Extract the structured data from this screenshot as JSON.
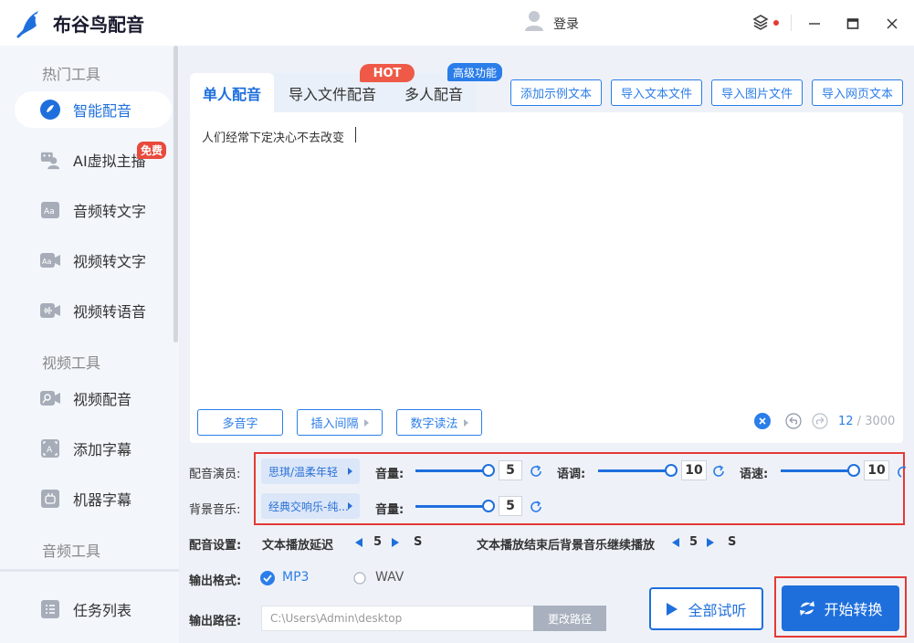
{
  "app": {
    "name": "布谷鸟配音",
    "login_label": "登录"
  },
  "sidebar": {
    "sections": [
      "热门工具",
      "视频工具",
      "音频工具"
    ],
    "items": [
      {
        "label": "智能配音",
        "icon": "smart-dub-icon"
      },
      {
        "label": "AI虚拟主播",
        "icon": "virtual-anchor-icon",
        "badge": "免费"
      },
      {
        "label": "音频转文字",
        "icon": "audio-to-text-icon"
      },
      {
        "label": "视频转文字",
        "icon": "video-to-text-icon"
      },
      {
        "label": "视频转语音",
        "icon": "video-to-voice-icon"
      },
      {
        "label": "视频配音",
        "icon": "video-dub-icon"
      },
      {
        "label": "添加字幕",
        "icon": "add-subtitle-icon"
      },
      {
        "label": "机器字幕",
        "icon": "machine-subtitle-icon"
      },
      {
        "label": "任务列表",
        "icon": "task-list-icon"
      }
    ]
  },
  "tabs": [
    {
      "label": "单人配音"
    },
    {
      "label": "导入文件配音",
      "badge": "HOT"
    },
    {
      "label": "多人配音",
      "badge": "高级功能"
    }
  ],
  "toolbar_buttons": [
    "添加示例文本",
    "导入文本文件",
    "导入图片文件",
    "导入网页文本"
  ],
  "editor": {
    "text": "人们经常下定决心不去改变",
    "buttons": [
      "多音字",
      "插入间隔",
      "数字读法"
    ],
    "count": "12",
    "max": " / 3000"
  },
  "voice": {
    "actor_label": "配音演员:",
    "actor_value": "思琪/温柔年轻",
    "volume_label": "音量:",
    "volume_value": "5",
    "pitch_label": "语调:",
    "pitch_value": "10",
    "speed_label": "语速:",
    "speed_value": "10",
    "bgm_label": "背景音乐:",
    "bgm_value": "经典交响乐-纯...",
    "bgm_volume_label": "音量:",
    "bgm_volume_value": "5"
  },
  "dub_settings": {
    "label": "配音设置:",
    "delay_label": "文本播放延迟",
    "delay_value": "5",
    "delay_unit": "S",
    "after_label": "文本播放结束后背景音乐继续播放",
    "after_value": "5",
    "after_unit": "S"
  },
  "output": {
    "format_label": "输出格式:",
    "formats": [
      "MP3",
      "WAV"
    ],
    "selected_format": "MP3",
    "path_label": "输出路径:",
    "path_value": "C:\\Users\\Admin\\desktop",
    "change_path_label": "更改路径"
  },
  "actions": {
    "preview_label": "全部试听",
    "start_label": "开始转换"
  },
  "colors": {
    "accent": "#1e6fdc",
    "highlight_border": "#e53935",
    "hot": "#ee5a47"
  }
}
